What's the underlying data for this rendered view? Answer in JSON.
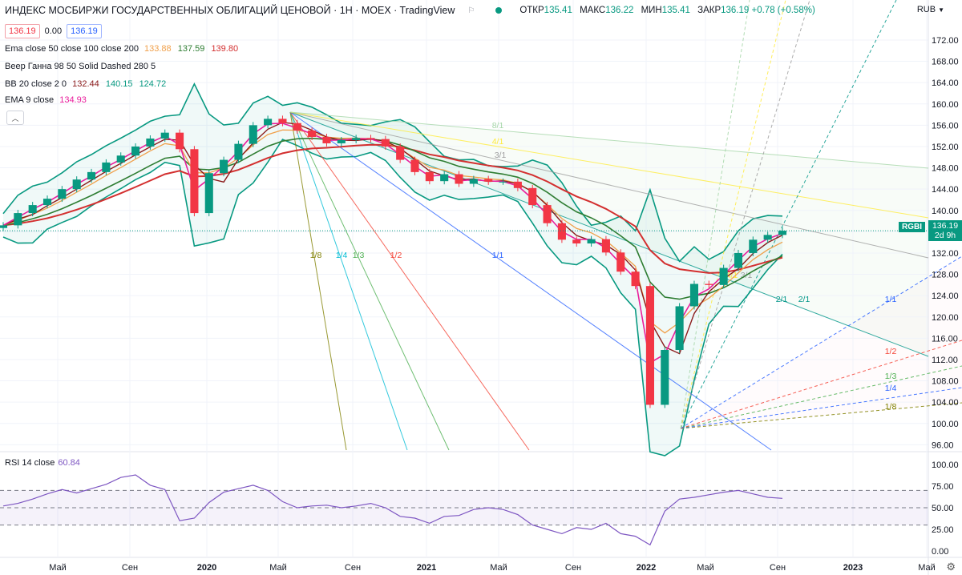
{
  "header": {
    "title": "ИНДЕКС МОСБИРЖИ ГОСУДАРСТВЕННЫХ ОБЛИГАЦИЙ ЦЕНОВОЙ · 1Н · MOEX · TradingView",
    "ohlc": [
      {
        "k": "ОТКР",
        "v": "135.41"
      },
      {
        "k": "МАКС",
        "v": "136.22"
      },
      {
        "k": "МИН",
        "v": "135.41"
      },
      {
        "k": "ЗАКР",
        "v": "136.19 +0.78 (+0.58%)"
      }
    ],
    "currency": "RUB",
    "bid": "136.19",
    "spread": "0.00",
    "ask": "136.19"
  },
  "indicators": [
    {
      "name": "Ema close 50 close 100 close 200",
      "values": [
        {
          "v": "133.88",
          "color": "#f0a04b"
        },
        {
          "v": "137.59",
          "color": "#2e7d32"
        },
        {
          "v": "139.80",
          "color": "#d32f2f"
        }
      ]
    },
    {
      "name": "Веер Ганна 98 50 Solid Dashed 280 5",
      "values": []
    },
    {
      "name": "BB 20 close 2 0",
      "values": [
        {
          "v": "132.44",
          "color": "#8b1a1a"
        },
        {
          "v": "140.15",
          "color": "#089981"
        },
        {
          "v": "124.72",
          "color": "#089981"
        }
      ]
    },
    {
      "name": "EMA 9 close",
      "values": [
        {
          "v": "134.93",
          "color": "#e91e9c"
        }
      ]
    }
  ],
  "rsi": {
    "label": "RSI 14 close",
    "value": "60.84"
  },
  "last_price": {
    "symbol": "RGBI",
    "price": "136.19",
    "countdown": "2d 9h"
  },
  "colors": {
    "up": "#089981",
    "down": "#f23645",
    "ema50": "#f0a04b",
    "ema100": "#2e7d32",
    "ema200": "#d32f2f",
    "bb": "#089981",
    "bb_basis": "#8b1a1a",
    "ema9": "#e91e9c",
    "rsi": "#7e57c2"
  },
  "chart_data": [
    {
      "type": "line",
      "ylim": [
        95,
        175
      ],
      "y_ticks": [
        "172.00",
        "168.00",
        "164.00",
        "160.00",
        "156.00",
        "152.00",
        "148.00",
        "144.00",
        "140.00",
        "136.00",
        "132.00",
        "128.00",
        "124.00",
        "120.00",
        "116.00",
        "112.00",
        "108.00",
        "104.00",
        "100.00",
        "96.00"
      ],
      "x_ticks": [
        "Май",
        "Сен",
        "2020",
        "Май",
        "Сен",
        "2021",
        "Май",
        "Сен",
        "2022",
        "Май",
        "Сен",
        "2023",
        "Май"
      ],
      "fan_labels": [
        "1/8",
        "1/4",
        "1/3",
        "1/2",
        "1/1",
        "2/1",
        "3/1",
        "4/1",
        "8/1",
        "1/8",
        "1/4",
        "1/3",
        "1/2",
        "1/1",
        "2/1",
        "3/1",
        "4/1"
      ],
      "series": [
        {
          "name": "RGBI",
          "values": [
            137.2,
            139.5,
            141.0,
            142.2,
            144.0,
            145.8,
            147.2,
            149.0,
            150.3,
            152.0,
            153.5,
            154.6,
            151.5,
            139.5,
            147.0,
            149.5,
            152.5,
            156.0,
            157.2,
            156.4,
            155.0,
            153.8,
            152.6,
            153.2,
            153.6,
            153.4,
            152.0,
            149.5,
            147.2,
            145.5,
            146.8,
            145.0,
            145.9,
            145.4,
            145.4,
            144.2,
            141.0,
            137.6,
            134.5,
            133.8,
            134.6,
            132.1,
            128.5,
            125.8,
            103.5,
            113.8,
            122.0,
            126.2,
            126.0,
            129.2,
            132.0,
            134.5,
            135.4,
            136.19
          ]
        }
      ]
    },
    {
      "type": "line",
      "ylim": [
        0,
        100
      ],
      "y_ticks": [
        "100.00",
        "75.00",
        "50.00",
        "25.00",
        "0.00"
      ],
      "series": [
        {
          "name": "RSI 14 close",
          "values": [
            52,
            55,
            60,
            66,
            71,
            67,
            72,
            77,
            85,
            88,
            76,
            71,
            35,
            38,
            56,
            68,
            72,
            76,
            70,
            57,
            50,
            52,
            53,
            50,
            52,
            55,
            50,
            40,
            38,
            32,
            40,
            41,
            48,
            50,
            48,
            42,
            30,
            25,
            20,
            27,
            25,
            32,
            20,
            17,
            7,
            46,
            60,
            62,
            65,
            68,
            70,
            66,
            62,
            60.84
          ]
        }
      ]
    }
  ]
}
